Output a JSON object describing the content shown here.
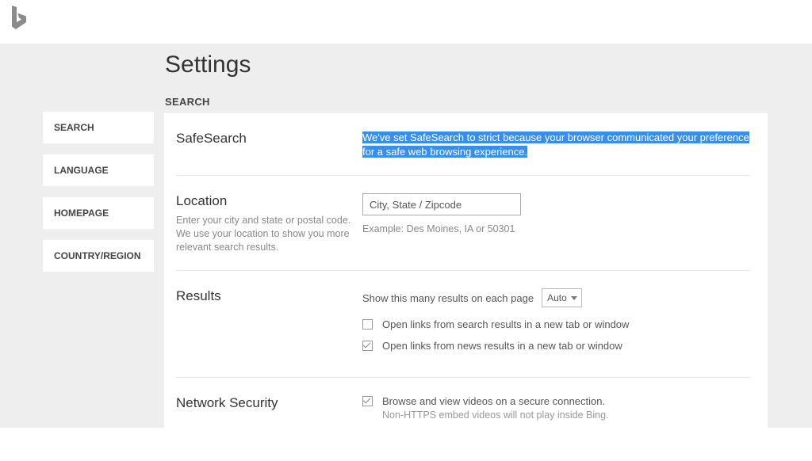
{
  "page_title": "Settings",
  "section_heading": "SEARCH",
  "sidebar": {
    "items": [
      "SEARCH",
      "LANGUAGE",
      "HOMEPAGE",
      "COUNTRY/REGION"
    ]
  },
  "safesearch": {
    "title": "SafeSearch",
    "notice": "We've set SafeSearch to strict because your browser communicated your preference for a safe web browsing experience."
  },
  "location": {
    "title": "Location",
    "desc": "Enter your city and state or postal code. We use your location to show you more relevant search results.",
    "placeholder": "City, State / Zipcode",
    "example": "Example: Des Moines, IA or 50301"
  },
  "results": {
    "title": "Results",
    "per_page_label": "Show this many results on each page",
    "per_page_value": "Auto",
    "open_search_new_tab": {
      "label": "Open links from search results in a new tab or window",
      "checked": false
    },
    "open_news_new_tab": {
      "label": "Open links from news results in a new tab or window",
      "checked": true
    }
  },
  "network": {
    "title": "Network Security",
    "secure": {
      "label": "Browse and view videos on a secure connection.",
      "sub": "Non-HTTPS embed videos will not play inside Bing.",
      "checked": true
    }
  }
}
